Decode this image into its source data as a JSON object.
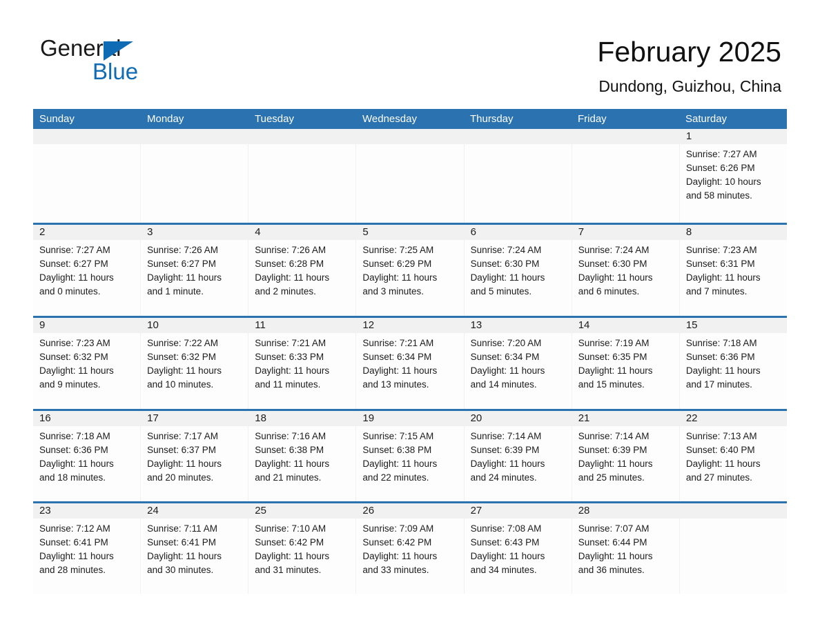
{
  "brand": {
    "name_part1": "General",
    "name_part2": "Blue",
    "triangle_color": "#0f6cb4"
  },
  "header": {
    "title": "February 2025",
    "location": "Dundong, Guizhou, China",
    "accent_color": "#2b72b0",
    "daynum_band_color": "#f1f1f1"
  },
  "calendar": {
    "day_names": [
      "Sunday",
      "Monday",
      "Tuesday",
      "Wednesday",
      "Thursday",
      "Friday",
      "Saturday"
    ],
    "labels": {
      "sunrise": "Sunrise:",
      "sunset": "Sunset:",
      "daylight": "Daylight:"
    },
    "weeks": [
      [
        {
          "day": ""
        },
        {
          "day": ""
        },
        {
          "day": ""
        },
        {
          "day": ""
        },
        {
          "day": ""
        },
        {
          "day": ""
        },
        {
          "day": "1",
          "sunrise": "Sunrise: 7:27 AM",
          "sunset": "Sunset: 6:26 PM",
          "daylight_line1": "Daylight: 10 hours",
          "daylight_line2": "and 58 minutes."
        }
      ],
      [
        {
          "day": "2",
          "sunrise": "Sunrise: 7:27 AM",
          "sunset": "Sunset: 6:27 PM",
          "daylight_line1": "Daylight: 11 hours",
          "daylight_line2": "and 0 minutes."
        },
        {
          "day": "3",
          "sunrise": "Sunrise: 7:26 AM",
          "sunset": "Sunset: 6:27 PM",
          "daylight_line1": "Daylight: 11 hours",
          "daylight_line2": "and 1 minute."
        },
        {
          "day": "4",
          "sunrise": "Sunrise: 7:26 AM",
          "sunset": "Sunset: 6:28 PM",
          "daylight_line1": "Daylight: 11 hours",
          "daylight_line2": "and 2 minutes."
        },
        {
          "day": "5",
          "sunrise": "Sunrise: 7:25 AM",
          "sunset": "Sunset: 6:29 PM",
          "daylight_line1": "Daylight: 11 hours",
          "daylight_line2": "and 3 minutes."
        },
        {
          "day": "6",
          "sunrise": "Sunrise: 7:24 AM",
          "sunset": "Sunset: 6:30 PM",
          "daylight_line1": "Daylight: 11 hours",
          "daylight_line2": "and 5 minutes."
        },
        {
          "day": "7",
          "sunrise": "Sunrise: 7:24 AM",
          "sunset": "Sunset: 6:30 PM",
          "daylight_line1": "Daylight: 11 hours",
          "daylight_line2": "and 6 minutes."
        },
        {
          "day": "8",
          "sunrise": "Sunrise: 7:23 AM",
          "sunset": "Sunset: 6:31 PM",
          "daylight_line1": "Daylight: 11 hours",
          "daylight_line2": "and 7 minutes."
        }
      ],
      [
        {
          "day": "9",
          "sunrise": "Sunrise: 7:23 AM",
          "sunset": "Sunset: 6:32 PM",
          "daylight_line1": "Daylight: 11 hours",
          "daylight_line2": "and 9 minutes."
        },
        {
          "day": "10",
          "sunrise": "Sunrise: 7:22 AM",
          "sunset": "Sunset: 6:32 PM",
          "daylight_line1": "Daylight: 11 hours",
          "daylight_line2": "and 10 minutes."
        },
        {
          "day": "11",
          "sunrise": "Sunrise: 7:21 AM",
          "sunset": "Sunset: 6:33 PM",
          "daylight_line1": "Daylight: 11 hours",
          "daylight_line2": "and 11 minutes."
        },
        {
          "day": "12",
          "sunrise": "Sunrise: 7:21 AM",
          "sunset": "Sunset: 6:34 PM",
          "daylight_line1": "Daylight: 11 hours",
          "daylight_line2": "and 13 minutes."
        },
        {
          "day": "13",
          "sunrise": "Sunrise: 7:20 AM",
          "sunset": "Sunset: 6:34 PM",
          "daylight_line1": "Daylight: 11 hours",
          "daylight_line2": "and 14 minutes."
        },
        {
          "day": "14",
          "sunrise": "Sunrise: 7:19 AM",
          "sunset": "Sunset: 6:35 PM",
          "daylight_line1": "Daylight: 11 hours",
          "daylight_line2": "and 15 minutes."
        },
        {
          "day": "15",
          "sunrise": "Sunrise: 7:18 AM",
          "sunset": "Sunset: 6:36 PM",
          "daylight_line1": "Daylight: 11 hours",
          "daylight_line2": "and 17 minutes."
        }
      ],
      [
        {
          "day": "16",
          "sunrise": "Sunrise: 7:18 AM",
          "sunset": "Sunset: 6:36 PM",
          "daylight_line1": "Daylight: 11 hours",
          "daylight_line2": "and 18 minutes."
        },
        {
          "day": "17",
          "sunrise": "Sunrise: 7:17 AM",
          "sunset": "Sunset: 6:37 PM",
          "daylight_line1": "Daylight: 11 hours",
          "daylight_line2": "and 20 minutes."
        },
        {
          "day": "18",
          "sunrise": "Sunrise: 7:16 AM",
          "sunset": "Sunset: 6:38 PM",
          "daylight_line1": "Daylight: 11 hours",
          "daylight_line2": "and 21 minutes."
        },
        {
          "day": "19",
          "sunrise": "Sunrise: 7:15 AM",
          "sunset": "Sunset: 6:38 PM",
          "daylight_line1": "Daylight: 11 hours",
          "daylight_line2": "and 22 minutes."
        },
        {
          "day": "20",
          "sunrise": "Sunrise: 7:14 AM",
          "sunset": "Sunset: 6:39 PM",
          "daylight_line1": "Daylight: 11 hours",
          "daylight_line2": "and 24 minutes."
        },
        {
          "day": "21",
          "sunrise": "Sunrise: 7:14 AM",
          "sunset": "Sunset: 6:39 PM",
          "daylight_line1": "Daylight: 11 hours",
          "daylight_line2": "and 25 minutes."
        },
        {
          "day": "22",
          "sunrise": "Sunrise: 7:13 AM",
          "sunset": "Sunset: 6:40 PM",
          "daylight_line1": "Daylight: 11 hours",
          "daylight_line2": "and 27 minutes."
        }
      ],
      [
        {
          "day": "23",
          "sunrise": "Sunrise: 7:12 AM",
          "sunset": "Sunset: 6:41 PM",
          "daylight_line1": "Daylight: 11 hours",
          "daylight_line2": "and 28 minutes."
        },
        {
          "day": "24",
          "sunrise": "Sunrise: 7:11 AM",
          "sunset": "Sunset: 6:41 PM",
          "daylight_line1": "Daylight: 11 hours",
          "daylight_line2": "and 30 minutes."
        },
        {
          "day": "25",
          "sunrise": "Sunrise: 7:10 AM",
          "sunset": "Sunset: 6:42 PM",
          "daylight_line1": "Daylight: 11 hours",
          "daylight_line2": "and 31 minutes."
        },
        {
          "day": "26",
          "sunrise": "Sunrise: 7:09 AM",
          "sunset": "Sunset: 6:42 PM",
          "daylight_line1": "Daylight: 11 hours",
          "daylight_line2": "and 33 minutes."
        },
        {
          "day": "27",
          "sunrise": "Sunrise: 7:08 AM",
          "sunset": "Sunset: 6:43 PM",
          "daylight_line1": "Daylight: 11 hours",
          "daylight_line2": "and 34 minutes."
        },
        {
          "day": "28",
          "sunrise": "Sunrise: 7:07 AM",
          "sunset": "Sunset: 6:44 PM",
          "daylight_line1": "Daylight: 11 hours",
          "daylight_line2": "and 36 minutes."
        },
        {
          "day": ""
        }
      ]
    ]
  }
}
